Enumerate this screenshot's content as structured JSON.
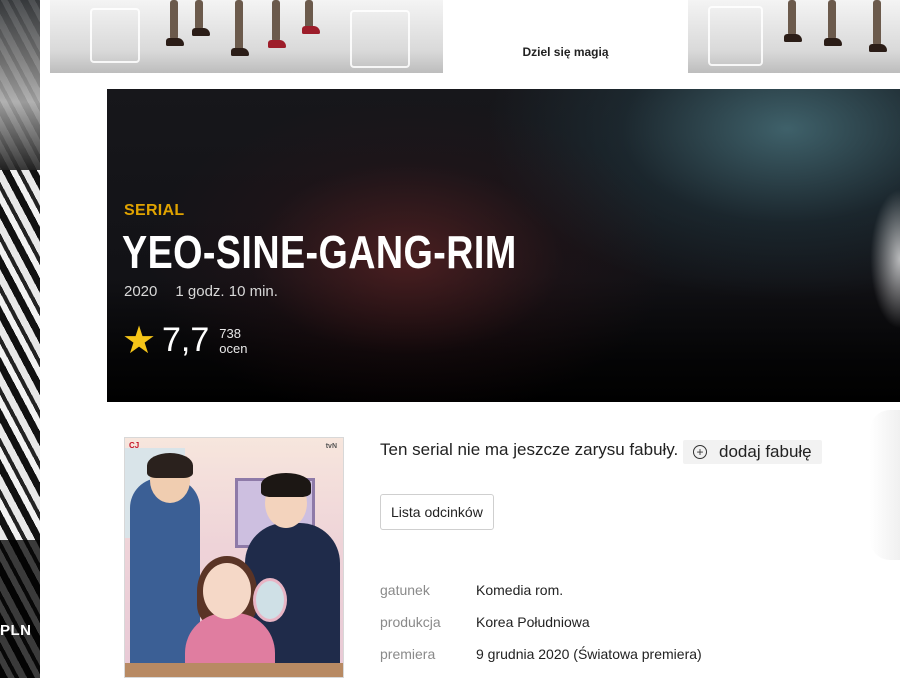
{
  "side_ad": {
    "price_fragment": "PLN"
  },
  "top_banner": {
    "middle_text": "Dziel się magią"
  },
  "hero": {
    "type_label": "SERIAL",
    "title": "YEO-SINE-GANG-RIM",
    "year": "2020",
    "duration": "1 godz. 10 min.",
    "rating": "7,7",
    "votes_count": "738",
    "votes_label": "ocen"
  },
  "plot": {
    "no_plot_text": "Ten serial nie ma jeszcze zarysu fabuły.",
    "add_plot_label": "dodaj fabułę"
  },
  "episodes_button_label": "Lista odcinków",
  "details": [
    {
      "key": "gatunek",
      "value": "Komedia rom."
    },
    {
      "key": "produkcja",
      "value": "Korea Południowa"
    },
    {
      "key": "premiera",
      "value": "9 grudnia 2020 (Światowa premiera)"
    }
  ],
  "colors": {
    "accent_type": "#e0a300",
    "star": "#f5c518",
    "hero_bg": "#121216"
  },
  "icons": {
    "rating": "star-icon",
    "add_plot": "plus-circle-icon"
  }
}
